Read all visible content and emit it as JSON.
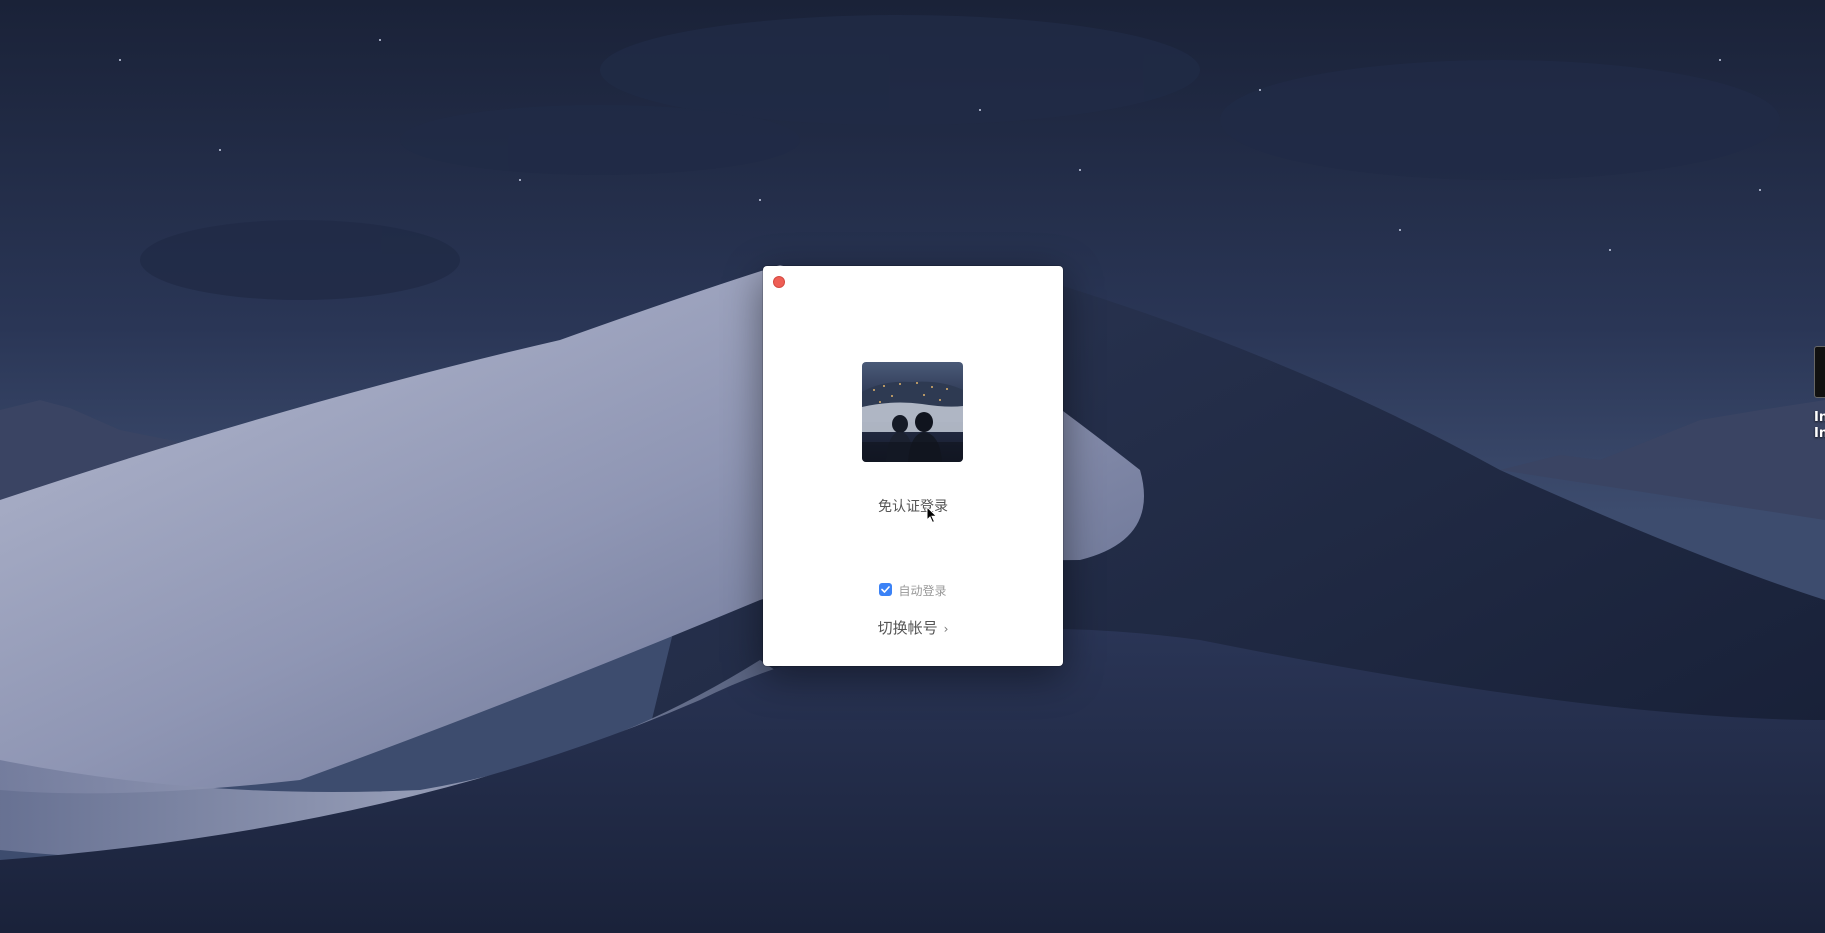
{
  "desktop": {
    "icon_label_line1": "In",
    "icon_label_line2": "In"
  },
  "login_window": {
    "primary_action": "免认证登录",
    "auto_login_label": "自动登录",
    "auto_login_checked": true,
    "switch_account_label": "切换帐号",
    "switch_account_chevron": "›"
  },
  "colors": {
    "close_button": "#ee5e55",
    "checkbox_accent": "#3b82f6",
    "sky_top": "#1a2238",
    "dune_light": "#8e95b3",
    "dune_dark": "#1c2741"
  },
  "icons": {
    "close": "close-icon",
    "checkbox": "checkmark-icon",
    "chevron": "chevron-right-icon",
    "cursor": "pointer-cursor-icon"
  }
}
